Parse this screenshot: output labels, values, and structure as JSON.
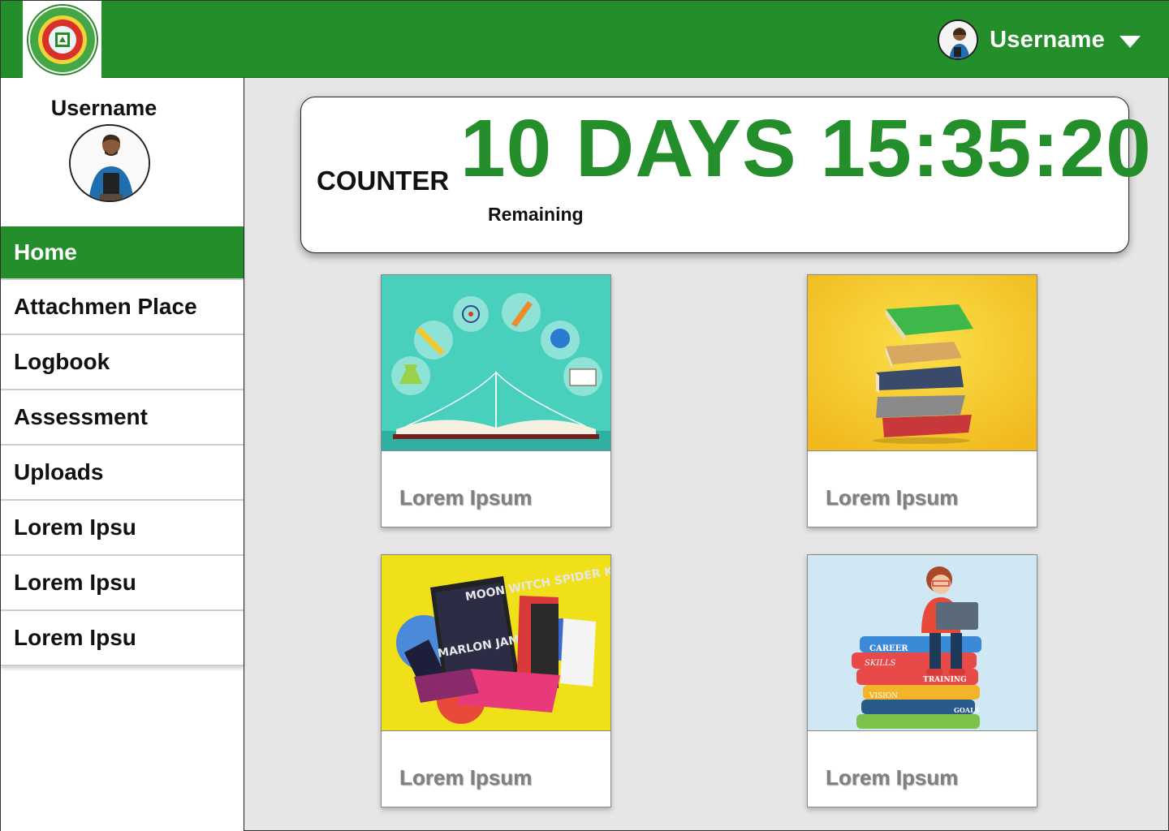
{
  "header": {
    "logo_icon": "university-seal-logo",
    "username": "Username",
    "menu_icon": "caret-down-icon",
    "brand_color": "#248f2a"
  },
  "sidebar": {
    "profile_name": "Username",
    "items": [
      {
        "label": "Home",
        "active": true
      },
      {
        "label": "Attachmen Place",
        "active": false
      },
      {
        "label": "Logbook",
        "active": false
      },
      {
        "label": "Assessment",
        "active": false
      },
      {
        "label": "Uploads",
        "active": false
      },
      {
        "label": "Lorem Ipsu",
        "active": false
      },
      {
        "label": "Lorem Ipsu",
        "active": false
      },
      {
        "label": "Lorem Ipsu",
        "active": false
      }
    ]
  },
  "counter": {
    "label": "COUNTER",
    "value": "10 DAYS 15:35:20",
    "sub": "Remaining"
  },
  "cards": [
    {
      "title": "Lorem Ipsum",
      "image": "open-book-science-icons"
    },
    {
      "title": "Lorem Ipsum",
      "image": "stack-of-books-yellow"
    },
    {
      "title": "Lorem Ipsum",
      "image": "colorful-novels-pile"
    },
    {
      "title": "Lorem Ipsum",
      "image": "student-on-career-books"
    }
  ],
  "book_labels": {
    "novel_title": "MOON WITCH SPIDER KING",
    "novel_author": "MARLON JAMES",
    "career": "CAREER",
    "skills": "SKILLS",
    "training": "TRAINING",
    "vision": "VISION",
    "goals": "GOALS"
  }
}
